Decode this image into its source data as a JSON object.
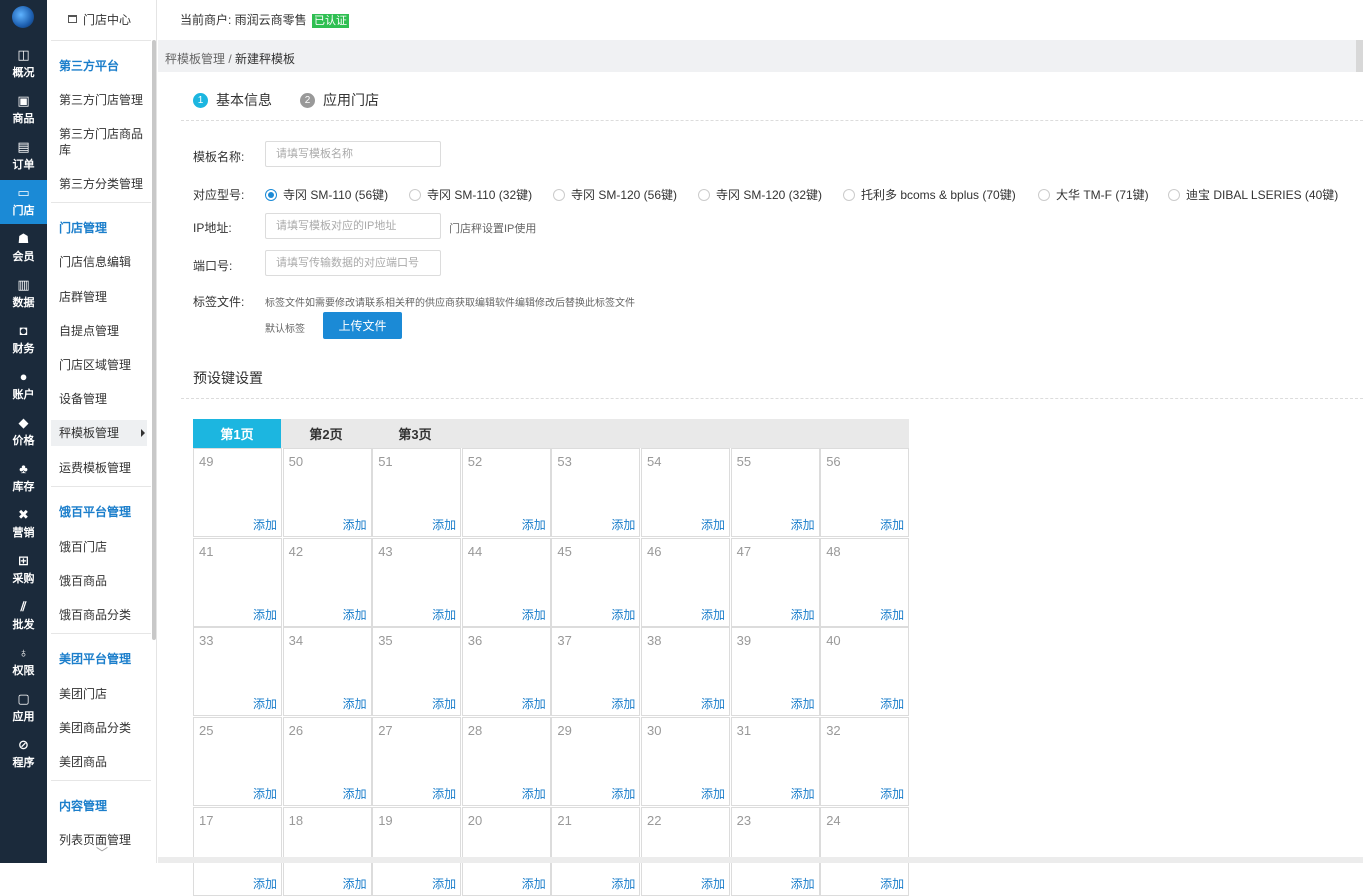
{
  "rail": {
    "items": [
      {
        "label": "概况",
        "icon": "dashboard-icon",
        "glyph": "◫"
      },
      {
        "label": "商品",
        "icon": "goods-icon",
        "glyph": "▣"
      },
      {
        "label": "订单",
        "icon": "order-icon",
        "glyph": "▤"
      },
      {
        "label": "门店",
        "icon": "store-icon",
        "glyph": "▭",
        "active": true
      },
      {
        "label": "会员",
        "icon": "member-icon",
        "glyph": "☗"
      },
      {
        "label": "数据",
        "icon": "data-icon",
        "glyph": "▥"
      },
      {
        "label": "财务",
        "icon": "finance-icon",
        "glyph": "◘"
      },
      {
        "label": "账户",
        "icon": "account-icon",
        "glyph": "●"
      },
      {
        "label": "价格",
        "icon": "price-icon",
        "glyph": "◆"
      },
      {
        "label": "库存",
        "icon": "stock-icon",
        "glyph": "♣"
      },
      {
        "label": "营销",
        "icon": "marketing-icon",
        "glyph": "✖"
      },
      {
        "label": "采购",
        "icon": "purchase-icon",
        "glyph": "⊞"
      },
      {
        "label": "批发",
        "icon": "wholesale-icon",
        "glyph": "⫽"
      },
      {
        "label": "权限",
        "icon": "permission-icon",
        "glyph": "♁"
      },
      {
        "label": "应用",
        "icon": "apps-icon",
        "glyph": "▢"
      },
      {
        "label": "程序",
        "icon": "program-icon",
        "glyph": "⊘"
      }
    ]
  },
  "sidebar": {
    "header": "门店中心",
    "groups": [
      {
        "title": "第三方平台",
        "links": [
          "第三方门店管理",
          "第三方门店商品库",
          "第三方分类管理"
        ]
      },
      {
        "title": "门店管理",
        "links": [
          "门店信息编辑",
          "店群管理",
          "自提点管理",
          "门店区域管理",
          "设备管理",
          "秤模板管理",
          "运费模板管理"
        ]
      },
      {
        "title": "饿百平台管理",
        "links": [
          "饿百门店",
          "饿百商品",
          "饿百商品分类"
        ]
      },
      {
        "title": "美团平台管理",
        "links": [
          "美团门店",
          "美团商品分类",
          "美团商品"
        ]
      },
      {
        "title": "内容管理",
        "links": [
          "列表页面管理"
        ]
      }
    ],
    "active_link": "秤模板管理",
    "more_glyph": "﹀"
  },
  "topbar": {
    "merchant_label": "当前商户: 雨润云商零售",
    "cert_badge": "已认证"
  },
  "breadcrumb": {
    "parent": "秤模板管理",
    "separator": " / ",
    "current": "新建秤模板"
  },
  "steps": [
    {
      "num": "1",
      "label": "基本信息",
      "active": true
    },
    {
      "num": "2",
      "label": "应用门店",
      "active": false
    }
  ],
  "form": {
    "name_label": "模板名称:",
    "name_placeholder": "请填写模板名称",
    "model_label": "对应型号:",
    "models": [
      {
        "label": "寺冈 SM-110 (56键)",
        "checked": true
      },
      {
        "label": "寺冈 SM-110 (32键)",
        "checked": false
      },
      {
        "label": "寺冈 SM-120 (56键)",
        "checked": false
      },
      {
        "label": "寺冈 SM-120 (32键)",
        "checked": false
      },
      {
        "label": "托利多 bcoms & bplus (70键)",
        "checked": false
      },
      {
        "label": "大华 TM-F (71键)",
        "checked": false
      },
      {
        "label": "迪宝 DIBAL LSERIES (40键)",
        "checked": false
      }
    ],
    "ip_label": "IP地址:",
    "ip_placeholder": "请填写模板对应的IP地址",
    "ip_hint": "门店秤设置IP使用",
    "port_label": "端口号:",
    "port_placeholder": "请填写传输数据的对应端口号",
    "file_label": "标签文件:",
    "file_hint": "标签文件如需要修改请联系相关秤的供应商获取编辑软件编辑修改后替换此标签文件",
    "file_default": "默认标签",
    "upload_button": "上传文件"
  },
  "keys": {
    "section_title": "预设键设置",
    "tabs": [
      "第1页",
      "第2页",
      "第3页"
    ],
    "active_tab": 0,
    "add_label": "添加",
    "rows": [
      [
        49,
        50,
        51,
        52,
        53,
        54,
        55,
        56
      ],
      [
        41,
        42,
        43,
        44,
        45,
        46,
        47,
        48
      ],
      [
        33,
        34,
        35,
        36,
        37,
        38,
        39,
        40
      ],
      [
        25,
        26,
        27,
        28,
        29,
        30,
        31,
        32
      ],
      [
        17,
        18,
        19,
        20,
        21,
        22,
        23,
        24
      ]
    ]
  },
  "colors": {
    "rail_bg": "#1b2a3b",
    "accent": "#1b8ad6",
    "tab_active": "#1cb6e0",
    "cert_green": "#2fbf52"
  }
}
